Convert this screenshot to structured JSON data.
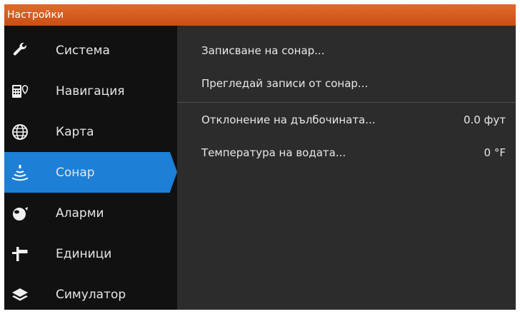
{
  "window": {
    "title": "Настройки"
  },
  "sidebar": {
    "items": [
      {
        "label": "Система",
        "icon": "wrench-icon"
      },
      {
        "label": "Навигация",
        "icon": "navigation-icon"
      },
      {
        "label": "Карта",
        "icon": "globe-icon"
      },
      {
        "label": "Сонар",
        "icon": "sonar-icon",
        "active": true
      },
      {
        "label": "Аларми",
        "icon": "alarm-icon"
      },
      {
        "label": "Единици",
        "icon": "units-icon"
      },
      {
        "label": "Симулатор",
        "icon": "layers-icon"
      }
    ]
  },
  "content": {
    "rows": [
      {
        "label": "Записване на сонар...",
        "value": ""
      },
      {
        "label": "Прегледай записи от сонар...",
        "value": ""
      },
      {
        "label": "Отклонение на дълбочината...",
        "value": "0.0 фут"
      },
      {
        "label": "Температура на водата...",
        "value": "0 °F"
      }
    ]
  },
  "colors": {
    "accent": "#1e7fd6",
    "titlebar": "#d45a1e",
    "sidebar": "#111111",
    "content": "#2c2c2c"
  }
}
